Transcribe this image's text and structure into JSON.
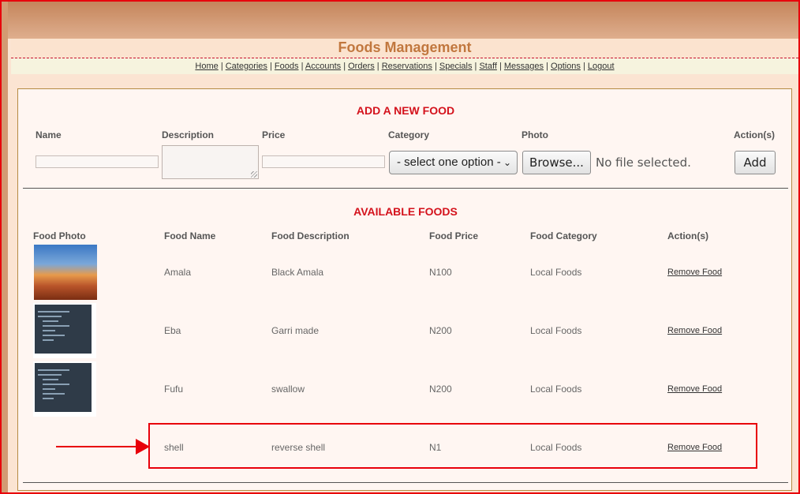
{
  "header": {
    "title": "Foods Management"
  },
  "nav": [
    "Home",
    "Categories",
    "Foods",
    "Accounts",
    "Orders",
    "Reservations",
    "Specials",
    "Staff",
    "Messages",
    "Options",
    "Logout"
  ],
  "add_form": {
    "title": "ADD A NEW FOOD",
    "labels": {
      "name": "Name",
      "description": "Description",
      "price": "Price",
      "category": "Category",
      "photo": "Photo",
      "actions": "Action(s)"
    },
    "category_selected": "- select one option -",
    "browse_label": "Browse...",
    "no_file": "No file selected.",
    "add_label": "Add"
  },
  "available": {
    "title": "AVAILABLE FOODS",
    "columns": [
      "Food Photo",
      "Food Name",
      "Food Description",
      "Food Price",
      "Food Category",
      "Action(s)"
    ],
    "remove_label": "Remove Food",
    "rows": [
      {
        "name": "Amala",
        "description": "Black Amala",
        "price": "N100",
        "category": "Local Foods",
        "photo": "desert-photo"
      },
      {
        "name": "Eba",
        "description": "Garri made",
        "price": "N200",
        "category": "Local Foods",
        "photo": "code-screenshot"
      },
      {
        "name": "Fufu",
        "description": "swallow",
        "price": "N200",
        "category": "Local Foods",
        "photo": "code-screenshot"
      },
      {
        "name": "shell",
        "description": "reverse shell",
        "price": "N1",
        "category": "Local Foods",
        "photo": ""
      }
    ]
  },
  "annotation": {
    "color": "#e8000b"
  },
  "icons": {
    "select_arrow": "chevron-down-icon",
    "annotation_arrow": "arrow-right-icon"
  }
}
